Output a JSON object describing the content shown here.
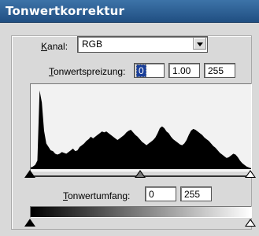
{
  "window": {
    "title": "Tonwertkorrektur"
  },
  "channel": {
    "label_first": "K",
    "label_rest": "anal:",
    "value": "RGB"
  },
  "input_levels": {
    "label_first": "T",
    "label_rest": "onwertspreizung:",
    "black": "0",
    "gamma": "1.00",
    "white": "255"
  },
  "histogram": {
    "values": [
      2,
      3,
      5,
      10,
      92,
      78,
      45,
      30,
      26,
      22,
      21,
      18,
      17,
      18,
      20,
      19,
      18,
      20,
      22,
      24,
      21,
      22,
      26,
      28,
      30,
      33,
      35,
      38,
      36,
      38,
      40,
      42,
      44,
      43,
      44,
      42,
      40,
      38,
      36,
      34,
      36,
      38,
      40,
      43,
      45,
      46,
      43,
      40,
      38,
      35,
      32,
      30,
      28,
      30,
      32,
      34,
      37,
      42,
      48,
      50,
      48,
      44,
      42,
      38,
      35,
      33,
      31,
      29,
      28,
      30,
      34,
      40,
      45,
      47,
      46,
      44,
      42,
      40,
      37,
      35,
      33,
      30,
      27,
      25,
      22,
      19,
      17,
      15,
      13,
      14,
      16,
      18,
      17,
      14,
      10,
      7,
      5,
      3,
      2,
      1
    ],
    "input_black_fraction": 0,
    "input_gamma_fraction": 0.5,
    "input_white_fraction": 1
  },
  "output_levels": {
    "label_first": "T",
    "label_rest": "onwertumfang:",
    "black": "0",
    "white": "255",
    "black_fraction": 0,
    "white_fraction": 1
  }
}
